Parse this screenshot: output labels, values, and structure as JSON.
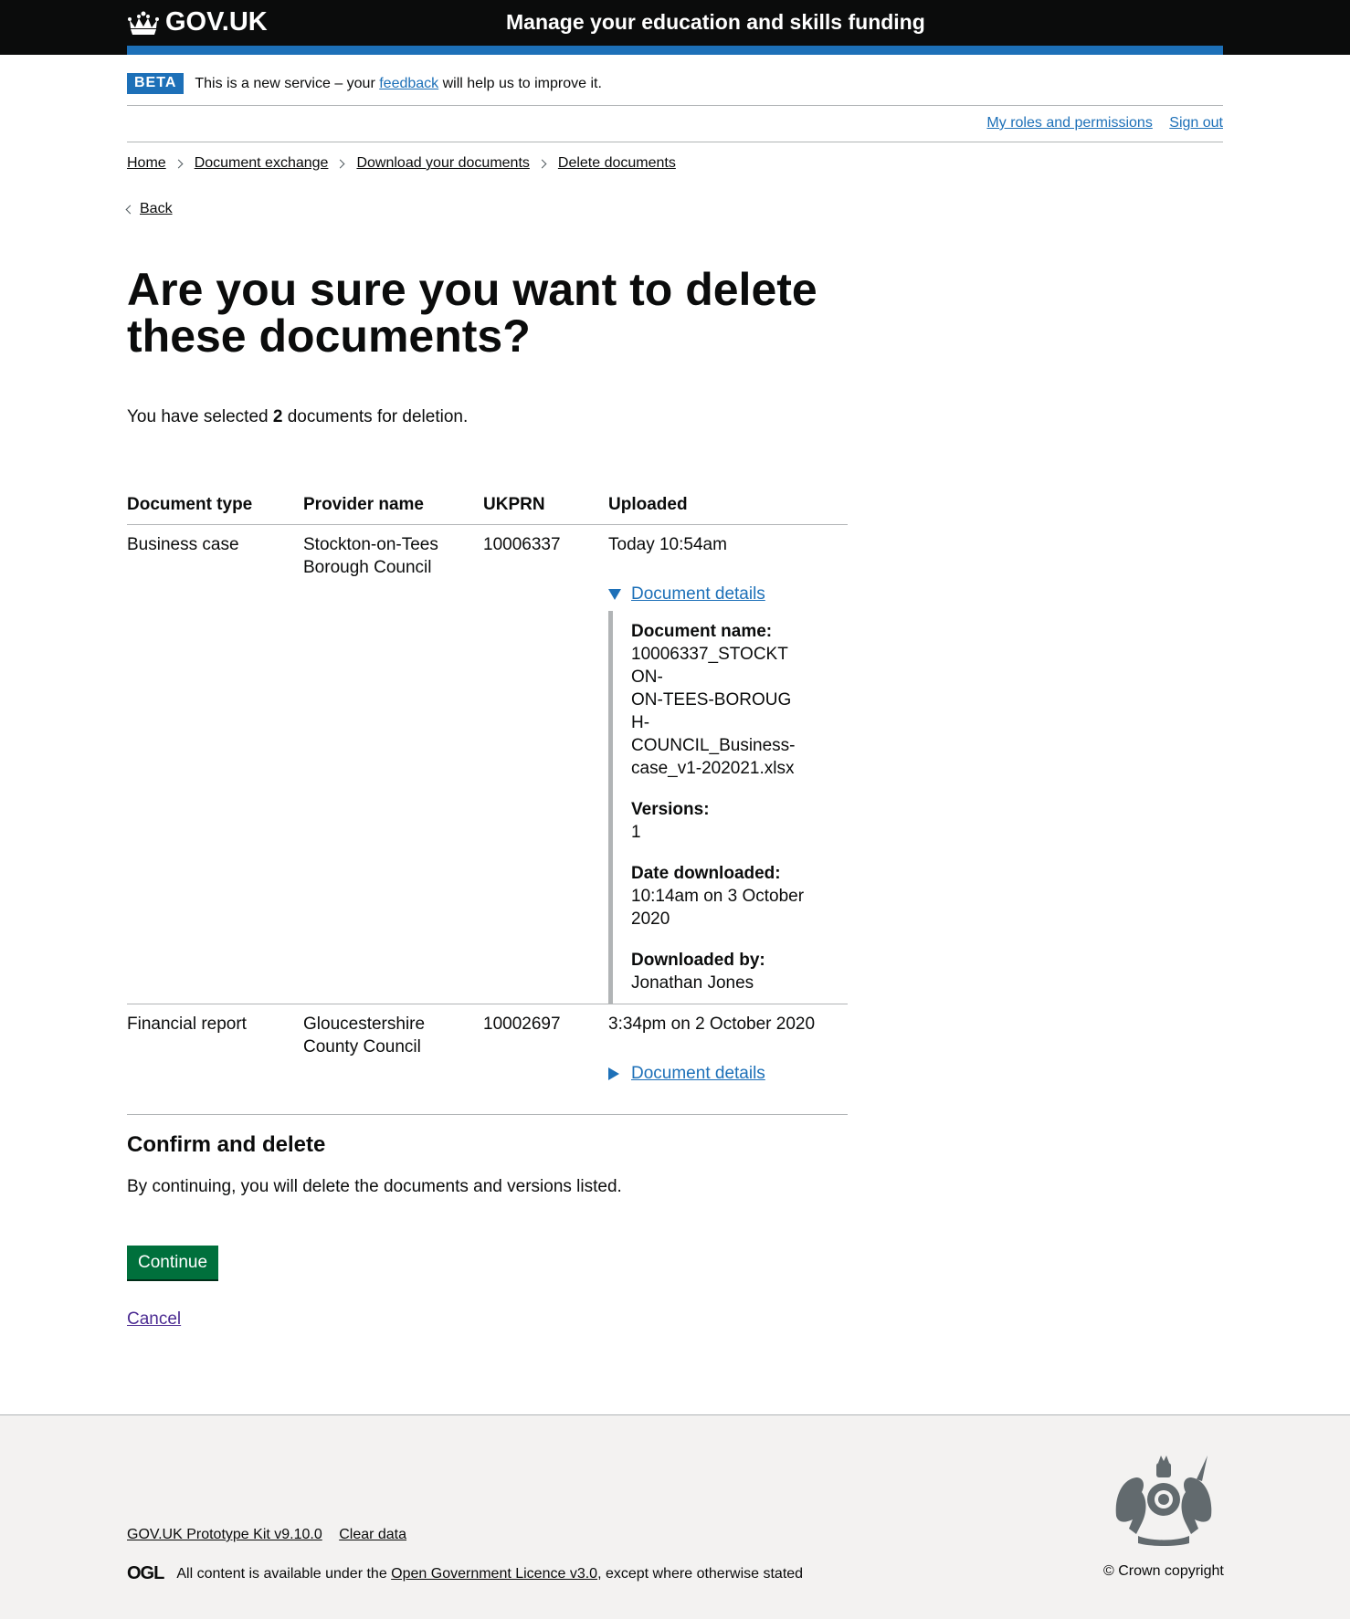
{
  "header": {
    "logo_text": "GOV.UK",
    "service_name": "Manage your education and skills funding"
  },
  "phase_banner": {
    "tag": "BETA",
    "text_before": "This is a new service – your ",
    "link": "feedback",
    "text_after": " will help us to improve it."
  },
  "top_nav": {
    "roles": "My roles and permissions",
    "sign_out": "Sign out"
  },
  "breadcrumbs": [
    "Home",
    "Document exchange",
    "Download your documents",
    "Delete documents"
  ],
  "back_link": "Back",
  "page_title": "Are you sure you want to delete these documents?",
  "lead": {
    "before": "You have selected ",
    "count": "2",
    "after": " documents for deletion."
  },
  "table": {
    "headers": [
      "Document type",
      "Provider name",
      "UKPRN",
      "Uploaded"
    ],
    "rows": [
      {
        "type": "Business case",
        "provider": "Stockton-on-Tees Borough Council",
        "ukprn": "10006337",
        "uploaded": "Today 10:54am",
        "details_label": "Document details",
        "details": {
          "name_label": "Document name:",
          "name_value": "10006337_STOCKTON-ON-TEES-BOROUGH-COUNCIL_Business-case_v1-202021.xlsx",
          "versions_label": "Versions:",
          "versions_value": "1",
          "downloaded_label": "Date downloaded:",
          "downloaded_value": "10:14am on 3 October 2020",
          "by_label": "Downloaded by:",
          "by_value": "Jonathan Jones"
        }
      },
      {
        "type": "Financial report",
        "provider": "Gloucestershire County Council",
        "ukprn": "10002697",
        "uploaded": "3:34pm on 2 October 2020",
        "details_label": "Document details"
      }
    ]
  },
  "confirm": {
    "heading": "Confirm and delete",
    "text": "By continuing, you will delete the documents and versions listed.",
    "button": "Continue",
    "cancel": "Cancel"
  },
  "footer": {
    "kit": "GOV.UK Prototype Kit v9.10.0",
    "clear": "Clear data",
    "ogl_logo": "OGL",
    "licence_before": "All content is available under the ",
    "licence_link": "Open Government Licence v3.0",
    "licence_after": ", except where otherwise stated",
    "copyright": "© Crown copyright"
  }
}
